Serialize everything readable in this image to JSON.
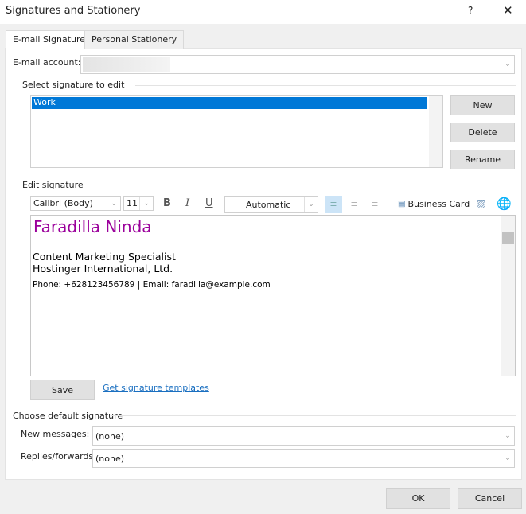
{
  "window": {
    "title": "Signatures and Stationery",
    "help": "?",
    "close": "✕"
  },
  "tabs": [
    {
      "label": "E-mail Signature"
    },
    {
      "label": "Personal Stationery"
    }
  ],
  "account": {
    "label": "E-mail account:",
    "value": ""
  },
  "select_group": {
    "label": "Select signature to edit",
    "items": [
      "Work"
    ]
  },
  "buttons": {
    "new": "New",
    "delete": "Delete",
    "rename": "Rename",
    "save": "Save",
    "ok": "OK",
    "cancel": "Cancel",
    "business_card": "Business Card"
  },
  "edit_group": {
    "label": "Edit signature",
    "font": "Calibri (Body)",
    "size": "11",
    "color": "Automatic",
    "bold": "B",
    "italic": "I",
    "underline": "U"
  },
  "signature": {
    "name": "Faradilla Ninda",
    "name_color": "#9b009b",
    "line1": "Content Marketing Specialist",
    "line2": "Hostinger International, Ltd.",
    "contact": "Phone: +628123456789 | Email: faradilla@example.com"
  },
  "templates_link": "Get signature templates",
  "defaults": {
    "label": "Choose default signature",
    "new_label": "New messages:",
    "new_value": "(none)",
    "replies_label": "Replies/forwards:",
    "replies_value": "(none)"
  },
  "colors": {
    "accent": "#0078d7",
    "link": "#1a6fc0"
  }
}
